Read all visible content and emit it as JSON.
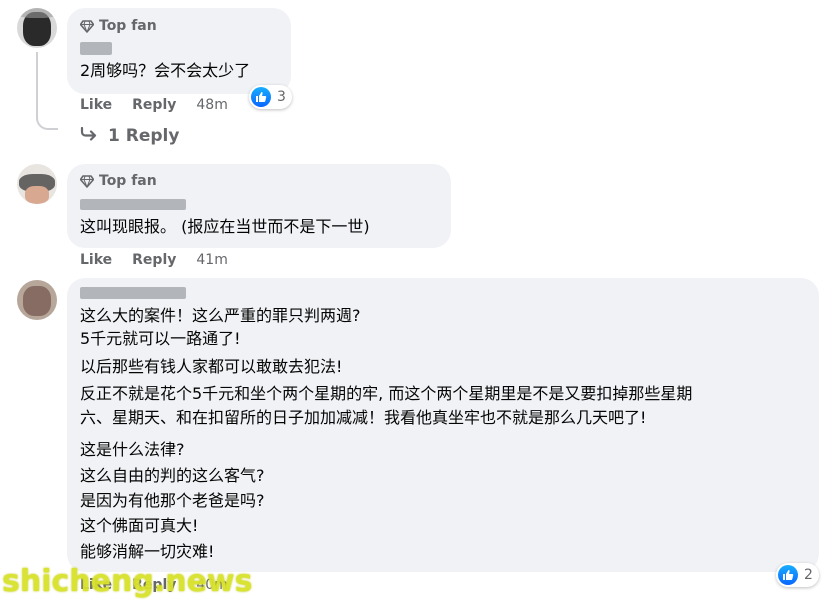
{
  "comments": [
    {
      "badge": "Top fan",
      "lines": [
        "2周够吗？会不会太少了"
      ],
      "like_label": "Like",
      "reply_label": "Reply",
      "time": "48m",
      "reaction_count": "3",
      "replies_label": "1 Reply"
    },
    {
      "badge": "Top fan",
      "lines": [
        "这叫现眼报。 (报应在当世而不是下一世)"
      ],
      "like_label": "Like",
      "reply_label": "Reply",
      "time": "41m"
    },
    {
      "lines": [
        "这么大的案件！这么严重的罪只判两週?",
        "5千元就可以一路通了!",
        "以后那些有钱人家都可以敢敢去犯法!",
        "反正不就是花个5千元和坐个两个星期的牢, 而这个两个星期里是不是又要扣掉那些星期",
        "六、星期天、和在扣留所的日子加加减减！我看他真坐牢也不就是那么几天吧了!",
        "",
        "这是什么法律?",
        "这么自由的判的这么客气?",
        "是因为有他那个老爸是吗?",
        "这个佛面可真大!",
        "能够消解一切灾难!"
      ],
      "like_label": "Like",
      "reply_label": "Reply",
      "time": "40m",
      "reaction_count": "2"
    }
  ],
  "icons": {
    "badge": "diamond-icon",
    "reaction": "thumbs-up-icon",
    "replies": "reply-arrow-icon"
  },
  "colors": {
    "bubble": "#f0f2f5",
    "secondary_text": "#65676b",
    "like_blue": "#0866ff",
    "watermark": "#d8e22a"
  },
  "watermark": "shicheng.news"
}
